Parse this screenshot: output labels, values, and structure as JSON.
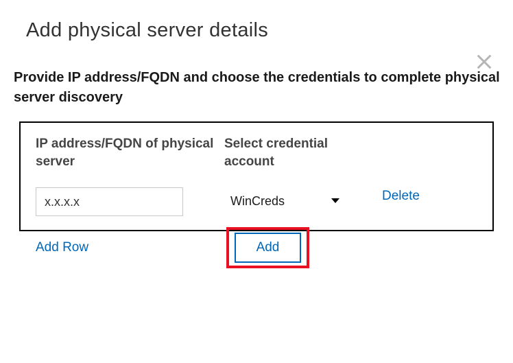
{
  "title": "Add physical server details",
  "instruction": "Provide IP address/FQDN and choose the credentials to complete physical server discovery",
  "columns": {
    "ip_header": "IP address/FQDN of physical server",
    "cred_header": "Select credential account"
  },
  "rows": [
    {
      "ip_value": "x.x.x.x",
      "cred_selected": "WinCreds",
      "delete_label": "Delete"
    }
  ],
  "add_row_label": "Add Row",
  "add_button_label": "Add"
}
